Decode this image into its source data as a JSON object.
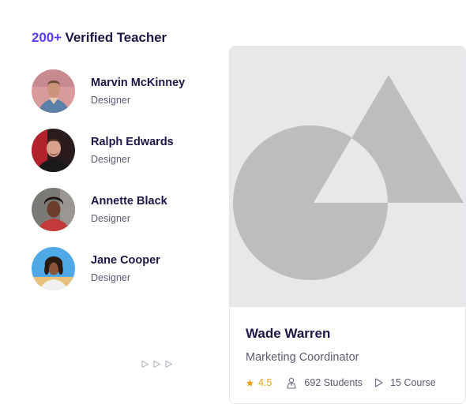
{
  "heading": {
    "accent": "200+",
    "rest": "Verified Teacher"
  },
  "teachers": [
    {
      "name": "Marvin McKinney",
      "role": "Designer",
      "avatar_icon": "avatar-photo"
    },
    {
      "name": "Ralph Edwards",
      "role": "Designer",
      "avatar_icon": "avatar-photo"
    },
    {
      "name": "Annette Black",
      "role": "Designer",
      "avatar_icon": "avatar-photo"
    },
    {
      "name": "Jane Cooper",
      "role": "Designer",
      "avatar_icon": "avatar-photo"
    }
  ],
  "pager": {
    "icons": [
      "play-arrow-icon",
      "play-arrow-icon",
      "play-arrow-icon"
    ]
  },
  "featured": {
    "name": "Wade Warren",
    "role": "Marketing Coordinator",
    "rating": "4.5",
    "students": "692 Students",
    "courses": "15 Course",
    "image_icon": "image-placeholder-icon"
  },
  "colors": {
    "accent": "#5b3ef5",
    "text_dark": "#1c1745",
    "text_muted": "#5c5a72",
    "star": "#e9a21b",
    "placeholder_bg": "#e8e8e8",
    "placeholder_shape": "#bdbdbd"
  }
}
